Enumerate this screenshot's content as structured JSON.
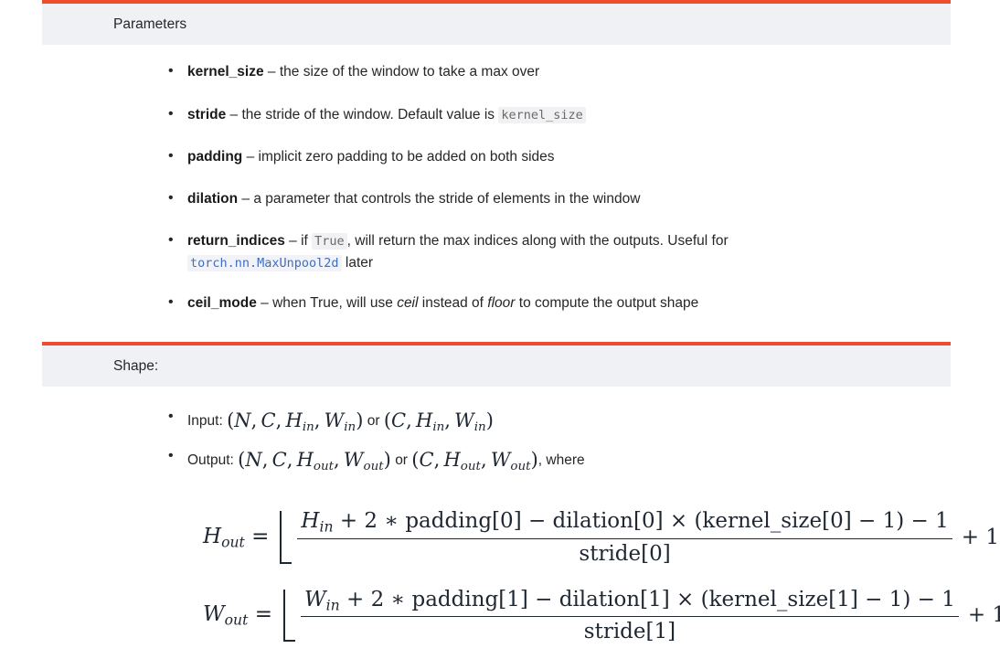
{
  "theme": {
    "accent_orange": "#ee4c2c",
    "header_bg": "#f0f1f5",
    "code_bg": "#f1f1f3",
    "code_fg": "#6a6a6a",
    "link_color": "#3c6fc4",
    "text_color": "#262626",
    "math_color": "#1f2733",
    "page_bg": "#ffffff"
  },
  "sections": {
    "parameters": {
      "title": "Parameters",
      "items": [
        {
          "name": "kernel_size",
          "dash": "–",
          "desc_before": "the size of the window to take a max over",
          "code": null,
          "desc_after": null
        },
        {
          "name": "stride",
          "dash": "–",
          "desc_before": "the stride of the window. Default value is",
          "code": "kernel_size",
          "desc_after": null
        },
        {
          "name": "padding",
          "dash": "–",
          "desc_before": "implicit zero padding to be added on both sides",
          "code": null,
          "desc_after": null
        },
        {
          "name": "dilation",
          "dash": "–",
          "desc_before": "a parameter that controls the stride of elements in the window",
          "code": null,
          "desc_after": null
        },
        {
          "name": "return_indices",
          "dash": "–",
          "desc_before": "if",
          "code": "True",
          "desc_after": ", will return the max indices along with the outputs. Useful for",
          "link_code": "torch.nn.MaxUnpool2d",
          "desc_tail": "later"
        },
        {
          "name": "ceil_mode",
          "dash": "–",
          "desc_before": "when True, will use",
          "italic_1": "ceil",
          "desc_mid": "instead of",
          "italic_2": "floor",
          "desc_after": "to compute the output shape"
        }
      ]
    },
    "shape": {
      "title": "Shape:",
      "items": [
        {
          "label": "Input:",
          "math_1": "(N, C, H_in, W_in)",
          "conj": "or",
          "math_2": "(C, H_in, W_in)",
          "trailing": ""
        },
        {
          "label": "Output:",
          "math_1": "(N, C, H_out, W_out)",
          "conj": "or",
          "math_2": "(C, H_out, W_out)",
          "trailing": ", where"
        }
      ],
      "formulas": [
        {
          "lhs_var": "H",
          "lhs_sub": "out",
          "equals": "=",
          "num_var": "H",
          "num_var_sub": "in",
          "numerator": "+ 2 ∗ padding[0] − dilation[0] × (kernel_size[0] − 1) − 1",
          "denominator": "stride[0]",
          "addend": "+ 1",
          "index": "0"
        },
        {
          "lhs_var": "W",
          "lhs_sub": "out",
          "equals": "=",
          "num_var": "W",
          "num_var_sub": "in",
          "numerator": "+ 2 ∗ padding[1] − dilation[1] × (kernel_size[1] − 1) − 1",
          "denominator": "stride[1]",
          "addend": "+ 1",
          "index": "1"
        }
      ]
    }
  }
}
